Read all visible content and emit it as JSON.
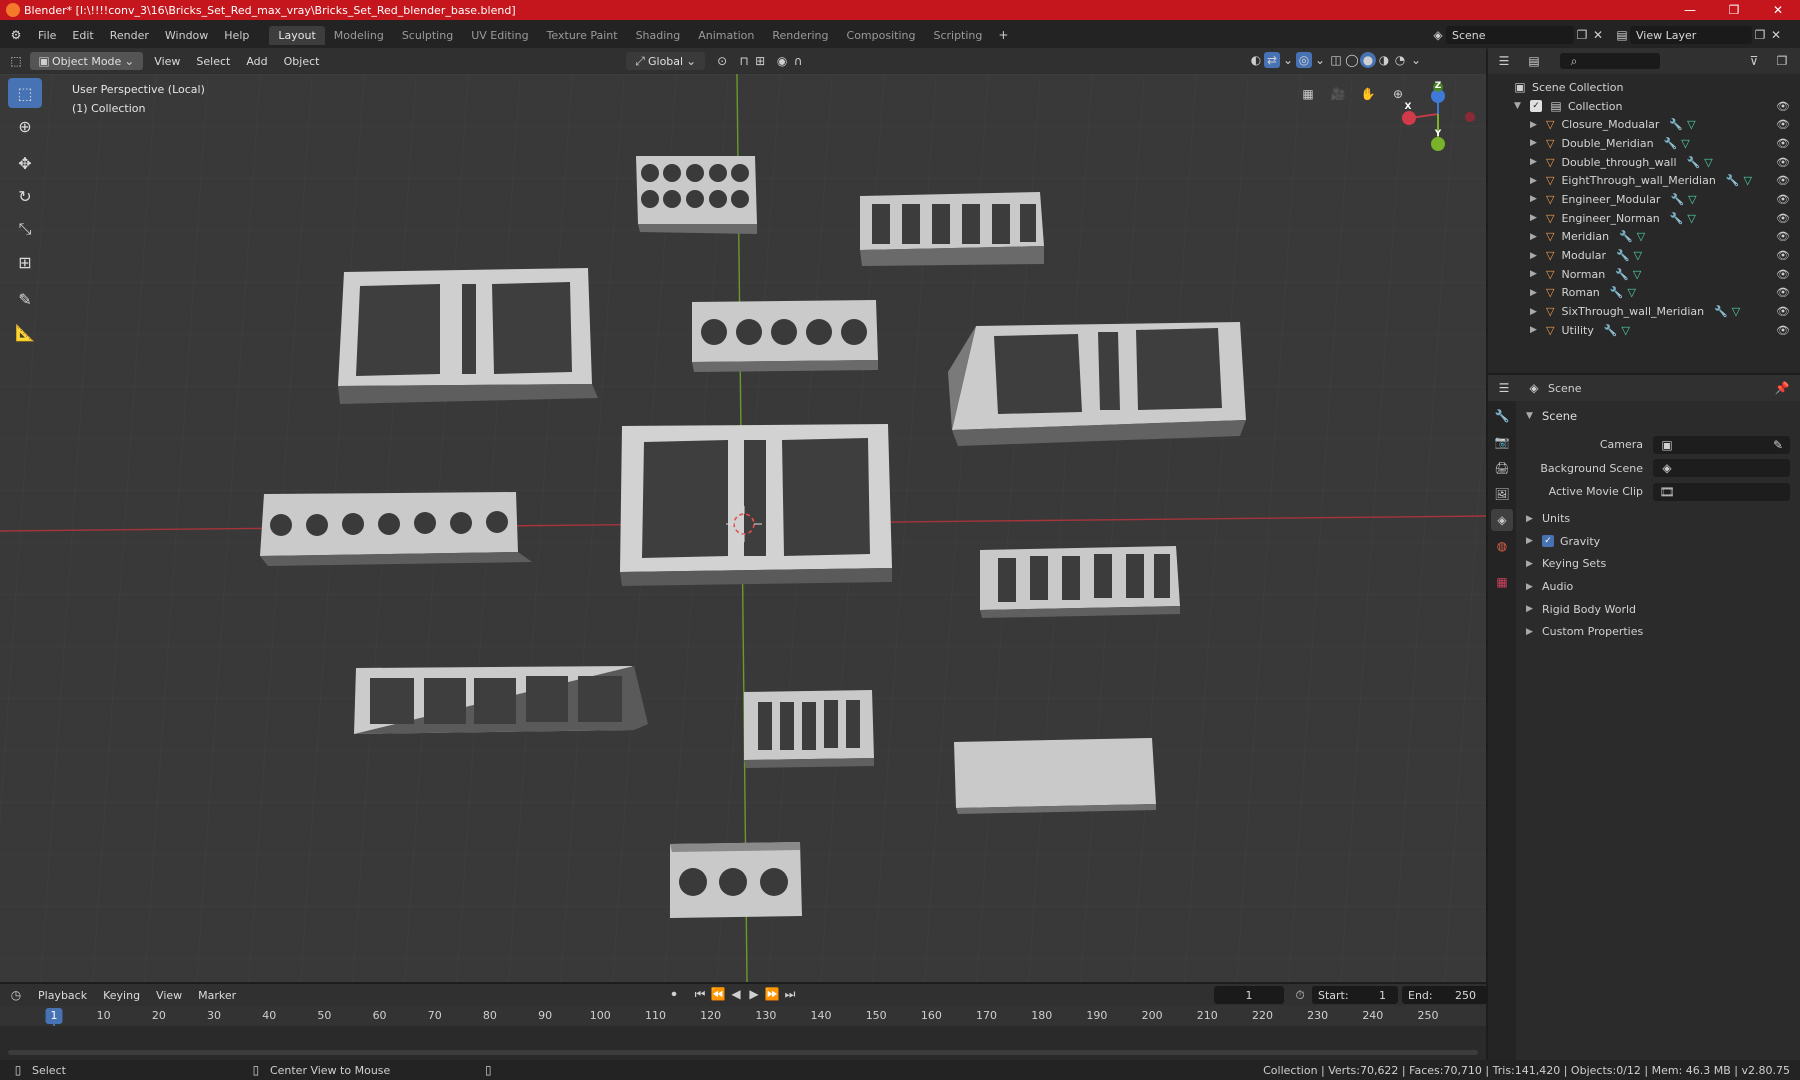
{
  "window": {
    "title": "Blender* [I:\\!!!!conv_3\\16\\Bricks_Set_Red_max_vray\\Bricks_Set_Red_blender_base.blend]",
    "controls": [
      "—",
      "❐",
      "✕"
    ]
  },
  "menu": [
    "File",
    "Edit",
    "Render",
    "Window",
    "Help"
  ],
  "workspaces": [
    {
      "label": "Layout",
      "active": true
    },
    {
      "label": "Modeling"
    },
    {
      "label": "Sculpting"
    },
    {
      "label": "UV Editing"
    },
    {
      "label": "Texture Paint"
    },
    {
      "label": "Shading"
    },
    {
      "label": "Animation"
    },
    {
      "label": "Rendering"
    },
    {
      "label": "Compositing"
    },
    {
      "label": "Scripting"
    }
  ],
  "scene_field": "Scene",
  "view_layer_field": "View Layer",
  "viewport_header": {
    "mode": "Object Mode",
    "menus": [
      "View",
      "Select",
      "Add",
      "Object"
    ],
    "transform_orientation": "Global"
  },
  "viewport": {
    "perspective": "User Perspective (Local)",
    "collection": "(1) Collection",
    "gizmo": {
      "x": "X",
      "y": "Y",
      "z": "Z"
    }
  },
  "outliner": {
    "root": "Scene Collection",
    "collection": "Collection",
    "objects": [
      "Closure_Modualar",
      "Double_Meridian",
      "Double_through_wall",
      "EightThrough_wall_Meridian",
      "Engineer_Modular",
      "Engineer_Norman",
      "Meridian",
      "Modular",
      "Norman",
      "Roman",
      "SixThrough_wall_Meridian",
      "Utility"
    ]
  },
  "properties": {
    "header": "Scene",
    "panel": "Scene",
    "fields": [
      {
        "label": "Camera",
        "value": ""
      },
      {
        "label": "Background Scene",
        "value": ""
      },
      {
        "label": "Active Movie Clip",
        "value": ""
      }
    ],
    "subpanels": [
      {
        "label": "Units",
        "checkbox": false
      },
      {
        "label": "Gravity",
        "checkbox": true
      },
      {
        "label": "Keying Sets",
        "checkbox": false
      },
      {
        "label": "Audio",
        "checkbox": false
      },
      {
        "label": "Rigid Body World",
        "checkbox": false
      },
      {
        "label": "Custom Properties",
        "checkbox": false
      }
    ]
  },
  "timeline": {
    "menus": [
      "Playback",
      "Keying",
      "View",
      "Marker"
    ],
    "current_frame": "1",
    "start_label": "Start:",
    "start": "1",
    "end_label": "End:",
    "end": "250",
    "ruler": [
      1,
      10,
      20,
      30,
      40,
      50,
      60,
      70,
      80,
      90,
      100,
      110,
      120,
      130,
      140,
      150,
      160,
      170,
      180,
      190,
      200,
      210,
      220,
      230,
      240,
      250
    ]
  },
  "status": {
    "left_action": "Select",
    "mid_action": "Center View to Mouse",
    "stats": "Collection | Verts:70,622 | Faces:70,710 | Tris:141,420 | Objects:0/12 | Mem: 46.3 MB | v2.80.75"
  }
}
